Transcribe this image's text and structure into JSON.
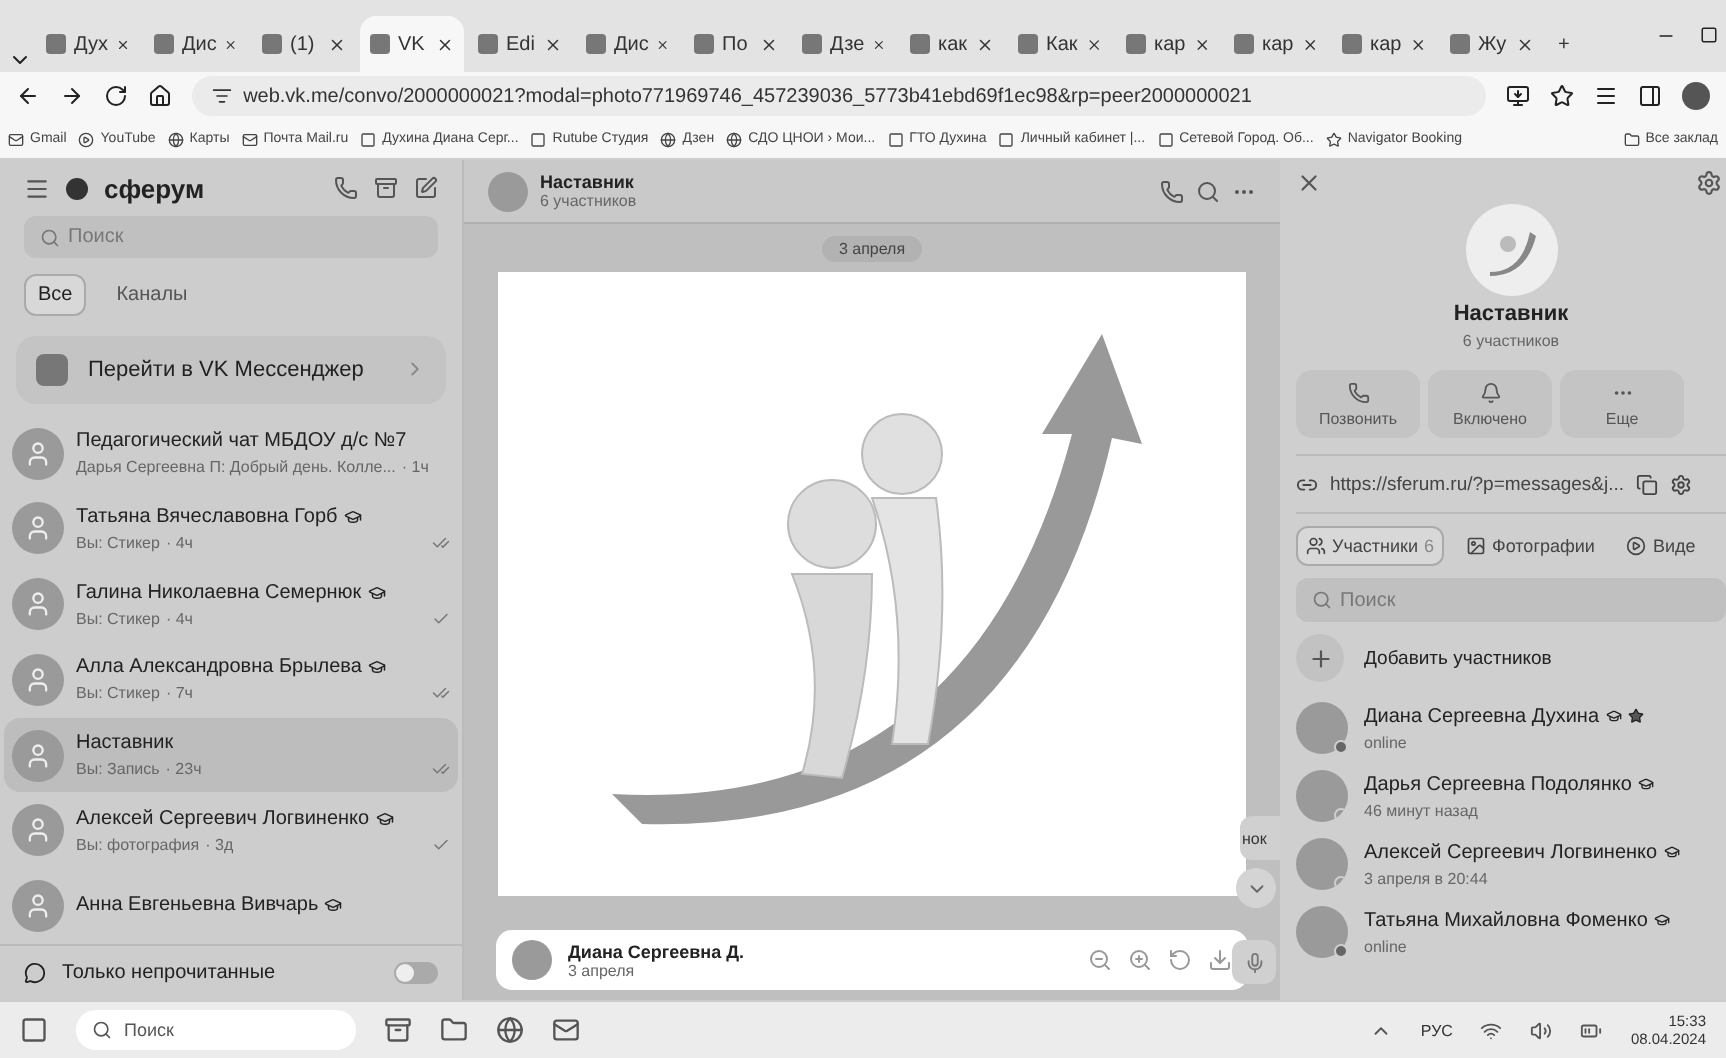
{
  "browser": {
    "tabs": [
      {
        "label": "Дух",
        "selected": false
      },
      {
        "label": "Дис",
        "selected": false
      },
      {
        "label": "(1)",
        "selected": false
      },
      {
        "label": "VK",
        "selected": true
      },
      {
        "label": "Edi",
        "selected": false
      },
      {
        "label": "Дис",
        "selected": false
      },
      {
        "label": "По",
        "selected": false
      },
      {
        "label": "Дзе",
        "selected": false
      },
      {
        "label": "как",
        "selected": false
      },
      {
        "label": "Как",
        "selected": false
      },
      {
        "label": "кар",
        "selected": false
      },
      {
        "label": "кар",
        "selected": false
      },
      {
        "label": "кар",
        "selected": false
      },
      {
        "label": "Жу",
        "selected": false
      }
    ],
    "new_tab": "+",
    "url": "web.vk.me/convo/2000000021?modal=photo771969746_457239036_5773b41ebd69f1ec98&rp=peer2000000021",
    "bookmarks": [
      "Gmail",
      "YouTube",
      "Карты",
      "Почта Mail.ru",
      "Духина Диана Серг...",
      "Rutube Студия",
      "Дзен",
      "СДО ЦНОИ › Мои...",
      "ГТО Духина",
      "Личный кабинет |...",
      "Сетевой Город. Об...",
      "Navigator Booking"
    ],
    "all_bookmarks": "Все заклад"
  },
  "sidebar": {
    "brand": "сферум",
    "search": {
      "placeholder": "Поиск"
    },
    "filters": [
      {
        "label": "Все",
        "selected": true
      },
      {
        "label": "Каналы",
        "selected": false
      }
    ],
    "promo": "Перейти в VK Мессенджер",
    "chats": [
      {
        "name": "Педагогический чат МБДОУ д/с №7",
        "preview": "Дарья Сергеевна П: Добрый день. Колле...",
        "time": "· 1ч",
        "verified": false,
        "selected": false
      },
      {
        "name": "Татьяна Вячеславовна Горб",
        "preview": "Вы: Стикер",
        "time": "· 4ч",
        "read": true,
        "verified": true,
        "selected": false
      },
      {
        "name": "Галина Николаевна Семернюк",
        "preview": "Вы: Стикер",
        "time": "· 4ч",
        "read": false,
        "verified": true,
        "selected": false
      },
      {
        "name": "Алла Александровна Брылева",
        "preview": "Вы: Стикер",
        "time": "· 7ч",
        "read": true,
        "verified": true,
        "selected": false
      },
      {
        "name": "Наставник",
        "preview": "Вы: Запись",
        "time": "· 23ч",
        "read": true,
        "verified": false,
        "selected": true
      },
      {
        "name": "Алексей Сергеевич Логвиненко",
        "preview": "Вы: фотография",
        "time": "· 3д",
        "read": false,
        "verified": true,
        "selected": false
      },
      {
        "name": "Анна Евгеньевна Вивчарь",
        "verified": true,
        "selected": false
      }
    ],
    "unread_only": {
      "label": "Только непрочитанные",
      "on": false
    }
  },
  "chat": {
    "title": "Наставник",
    "subtitle": "6 участников",
    "date": "3 апреля",
    "bubble_fragment": "нок",
    "photo_caption": {
      "author": "Диана Сергеевна Д.",
      "date": "3 апреля"
    }
  },
  "details": {
    "title": "Наставник",
    "subtitle": "6 участников",
    "actions": [
      "Позвонить",
      "Включено",
      "Еще"
    ],
    "link": "https://sferum.ru/?p=messages&j...",
    "tabs": [
      {
        "label": "Участники",
        "count": "6",
        "selected": true
      },
      {
        "label": "Фотографии",
        "selected": false
      },
      {
        "label": "Виде",
        "selected": false
      }
    ],
    "search": {
      "placeholder": "Поиск"
    },
    "add_members": "Добавить участников",
    "members": [
      {
        "name": "Диана Сергеевна Духина",
        "status": "online",
        "online": true,
        "star": true
      },
      {
        "name": "Дарья Сергеевна Подолянко",
        "status": "46 минут назад",
        "online": false,
        "star": false
      },
      {
        "name": "Алексей Сергеевич Логвиненко",
        "status": "3 апреля в 20:44",
        "online": false,
        "star": false
      },
      {
        "name": "Татьяна Михайловна Фоменко",
        "status": "online",
        "online": true,
        "star": false
      }
    ]
  },
  "taskbar": {
    "search": "Поиск",
    "language": "РУС",
    "time": "15:33",
    "date": "08.04.2024"
  }
}
